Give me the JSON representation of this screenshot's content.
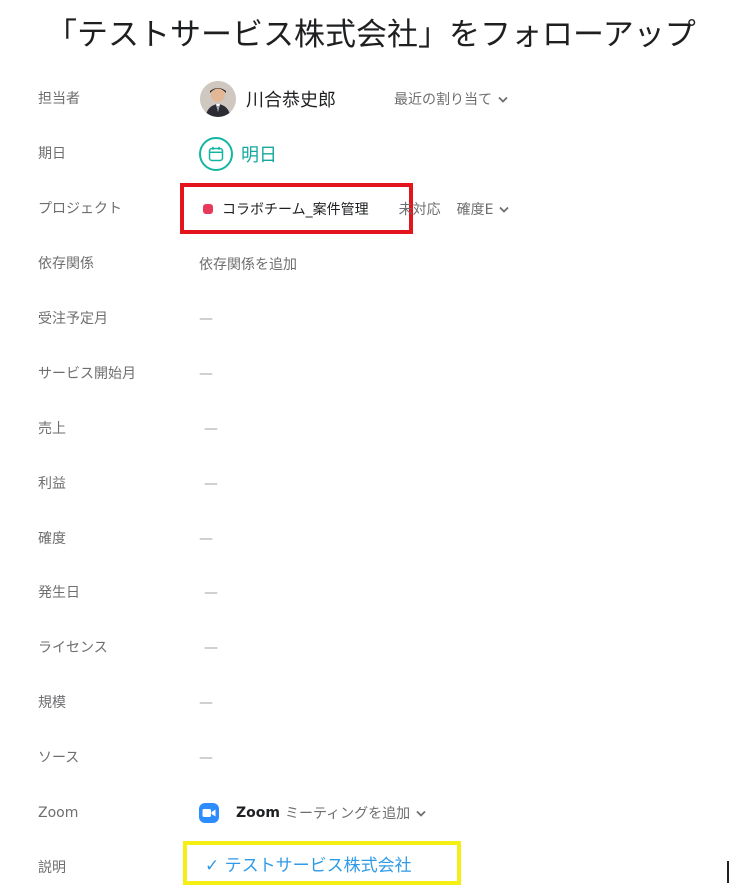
{
  "task_title": "「テストサービス株式会社」をフォローアップ",
  "fields": {
    "assignee": {
      "label": "担当者",
      "name": "川合恭史郎",
      "recent_label": "最近の割り当て"
    },
    "due_date": {
      "label": "期日",
      "value": "明日"
    },
    "project": {
      "label": "プロジェクト",
      "name": "コラボチーム_案件管理",
      "section": "未対応",
      "certainty": "確度E",
      "color": "#e8385b"
    },
    "dependencies": {
      "label": "依存関係",
      "action": "依存関係を追加"
    },
    "order_month": {
      "label": "受注予定月",
      "value": "—"
    },
    "service_start": {
      "label": "サービス開始月",
      "value": "—"
    },
    "sales": {
      "label": "売上",
      "value": "—"
    },
    "profit": {
      "label": "利益",
      "value": "—"
    },
    "certainty": {
      "label": "確度",
      "value": "—"
    },
    "occurred_date": {
      "label": "発生日",
      "value": "—"
    },
    "license": {
      "label": "ライセンス",
      "value": "—"
    },
    "scale": {
      "label": "規模",
      "value": "—"
    },
    "source": {
      "label": "ソース",
      "value": "—"
    },
    "zoom": {
      "label": "Zoom",
      "brand": "Zoom",
      "action": "ミーティングを追加"
    },
    "description": {
      "label": "説明",
      "text": "✓ テストサービス株式会社"
    }
  },
  "colors": {
    "accent_teal": "#14b6a3",
    "link_blue": "#2f9be8",
    "zoom_blue": "#2d8cff",
    "highlight_red": "#e3141c",
    "highlight_yellow": "#f5ef16"
  }
}
